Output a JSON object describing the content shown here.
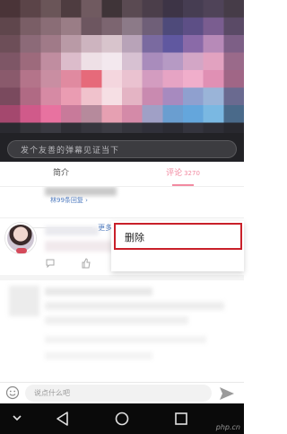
{
  "video": {
    "danmaku_placeholder": "发个友善的弹幕见证当下"
  },
  "tabs": [
    {
      "label": "简介",
      "count": ""
    },
    {
      "label": "评论",
      "count": "3270"
    }
  ],
  "comments": {
    "hot_reply_link": "林99条回复 ›",
    "more_hot_label": "更多热门评论 ›"
  },
  "context_menu": {
    "delete_label": "删除"
  },
  "input_bar": {
    "placeholder": "说点什么吧"
  },
  "colors": {
    "accent": "#f28aa1",
    "link": "#4f7bbf",
    "highlight_border": "#c9202a"
  },
  "icons": {
    "emoji": "emoji-icon",
    "send": "send-icon",
    "back": "nav-back-icon",
    "home": "nav-home-icon",
    "recent": "nav-recent-icon"
  },
  "watermark": "php.cn"
}
